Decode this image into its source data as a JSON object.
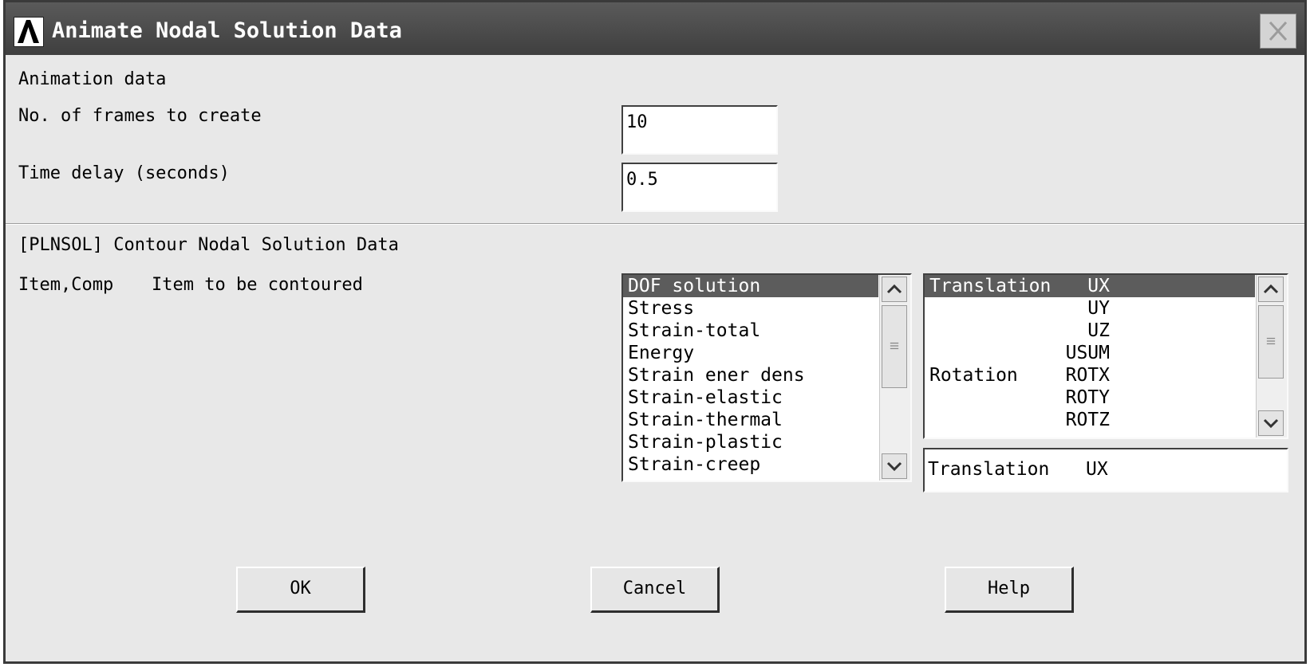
{
  "window": {
    "title": "Animate Nodal Solution Data"
  },
  "animation": {
    "section_label": "Animation data",
    "frames_label": "No. of frames to create",
    "frames_value": "10",
    "delay_label": "Time delay (seconds)",
    "delay_value": "0.5"
  },
  "contour": {
    "section_label": "[PLNSOL] Contour Nodal Solution Data",
    "item_label": "Item,Comp",
    "item_desc": "Item to be contoured",
    "items": [
      "DOF solution",
      "Stress",
      "Strain-total",
      "Energy",
      "Strain ener dens",
      "Strain-elastic",
      "Strain-thermal",
      "Strain-plastic",
      "Strain-creep"
    ],
    "components": [
      {
        "category": "Translation",
        "comp": "UX"
      },
      {
        "category": "",
        "comp": "UY"
      },
      {
        "category": "",
        "comp": "UZ"
      },
      {
        "category": "",
        "comp": "USUM"
      },
      {
        "category": "Rotation",
        "comp": "ROTX"
      },
      {
        "category": "",
        "comp": "ROTY"
      },
      {
        "category": "",
        "comp": "ROTZ"
      }
    ],
    "selection": {
      "category": "Translation",
      "comp": "UX"
    }
  },
  "buttons": {
    "ok": "OK",
    "cancel": "Cancel",
    "help": "Help"
  },
  "colors": {
    "title_bar": "#4a4a4a",
    "selected_row": "#5c5c5c",
    "dialog_bg": "#e8e8e8"
  }
}
